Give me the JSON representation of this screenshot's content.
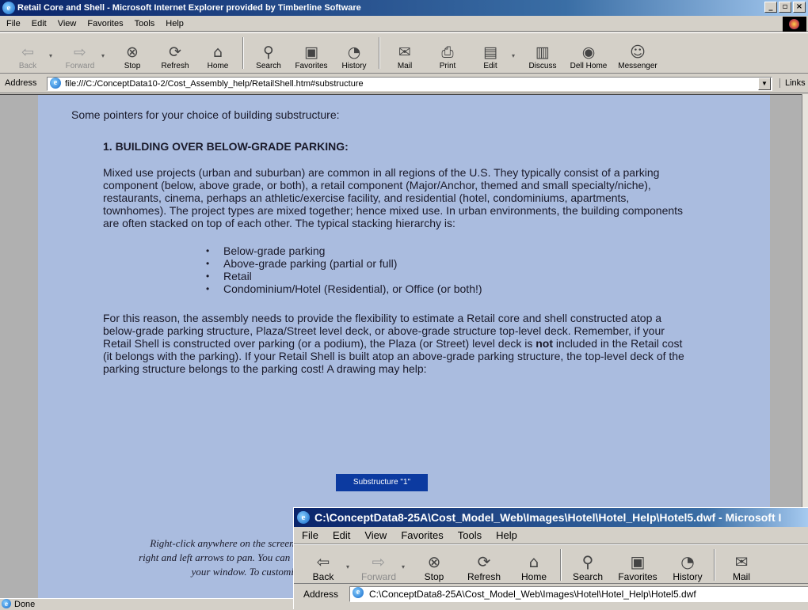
{
  "browser": {
    "title": "Retail Core and Shell - Microsoft Internet Explorer provided by Timberline Software",
    "menu": [
      "File",
      "Edit",
      "View",
      "Favorites",
      "Tools",
      "Help"
    ],
    "toolbar": {
      "back": "Back",
      "forward": "Forward",
      "stop": "Stop",
      "refresh": "Refresh",
      "home": "Home",
      "search": "Search",
      "favorites": "Favorites",
      "history": "History",
      "mail": "Mail",
      "print": "Print",
      "edit": "Edit",
      "discuss": "Discuss",
      "dell_home": "Dell Home",
      "messenger": "Messenger"
    },
    "address_label": "Address",
    "address_url": "file:///C:/ConceptData10-2/Cost_Assembly_help/RetailShell.htm#substructure",
    "links_label": "Links",
    "status": "Done"
  },
  "page": {
    "intro": "Some pointers for your choice of building substructure:",
    "heading": "1. BUILDING OVER BELOW-GRADE PARKING:",
    "para1": "Mixed use projects (urban and suburban) are common in all regions of the U.S. They typically consist of a parking component (below, above grade, or both), a retail component (Major/Anchor, themed and small specialty/niche), restaurants, cinema, perhaps an athletic/exercise facility, and residential (hotel, condominiums, apartments, townhomes). The project types are mixed together; hence mixed use. In urban environments, the building components are often stacked on top of each other. The typical stacking hierarchy is:",
    "bullets": [
      "Below-grade parking",
      "Above-grade parking (partial or full)",
      "Retail",
      "Condominium/Hotel (Residential), or Office (or both!)"
    ],
    "para2_before": "For this reason, the assembly needs to provide the flexibility to estimate a Retail core and shell constructed atop a below-grade parking structure, Plaza/Street level deck, or above-grade structure top-level deck. Remember, if your Retail Shell is constructed over parking (or a podium), the Plaza (or Street) level deck is ",
    "para2_bold": "not",
    "para2_after": " included in the Retail cost (it belongs with the parking). If your Retail Shell is built atop an above-grade parking structure, the top-level deck of the parking structure belongs to the parking cost! A drawing may help:",
    "substructure_button": "Substructure \"1\"",
    "note_lines": [
      "Right-click anywhere on the screen; ",
      "right and left arrows to pan. You can a",
      "your window. To customiz"
    ]
  },
  "popup": {
    "title": "C:\\ConceptData8-25A\\Cost_Model_Web\\Images\\Hotel\\Hotel_Help\\Hotel5.dwf - Microsoft I",
    "menu": [
      "File",
      "Edit",
      "View",
      "Favorites",
      "Tools",
      "Help"
    ],
    "toolbar": {
      "back": "Back",
      "forward": "Forward",
      "stop": "Stop",
      "refresh": "Refresh",
      "home": "Home",
      "search": "Search",
      "favorites": "Favorites",
      "history": "History",
      "mail": "Mail"
    },
    "address_label": "Address",
    "address_url": "C:\\ConceptData8-25A\\Cost_Model_Web\\Images\\Hotel\\Hotel_Help\\Hotel5.dwf"
  },
  "colors": {
    "page_background": "#aabcdf",
    "title_bar": "#0a246a",
    "button": "#0c3aa0"
  },
  "icons": {
    "back": "back-arrow-icon",
    "forward": "forward-arrow-icon",
    "stop": "stop-icon",
    "refresh": "refresh-icon",
    "home": "home-icon",
    "search": "search-icon",
    "favorites": "favorites-icon",
    "history": "history-icon",
    "mail": "mail-icon",
    "print": "print-icon",
    "edit": "edit-icon",
    "discuss": "discuss-icon",
    "dell_home": "dell-home-icon",
    "messenger": "messenger-icon"
  }
}
